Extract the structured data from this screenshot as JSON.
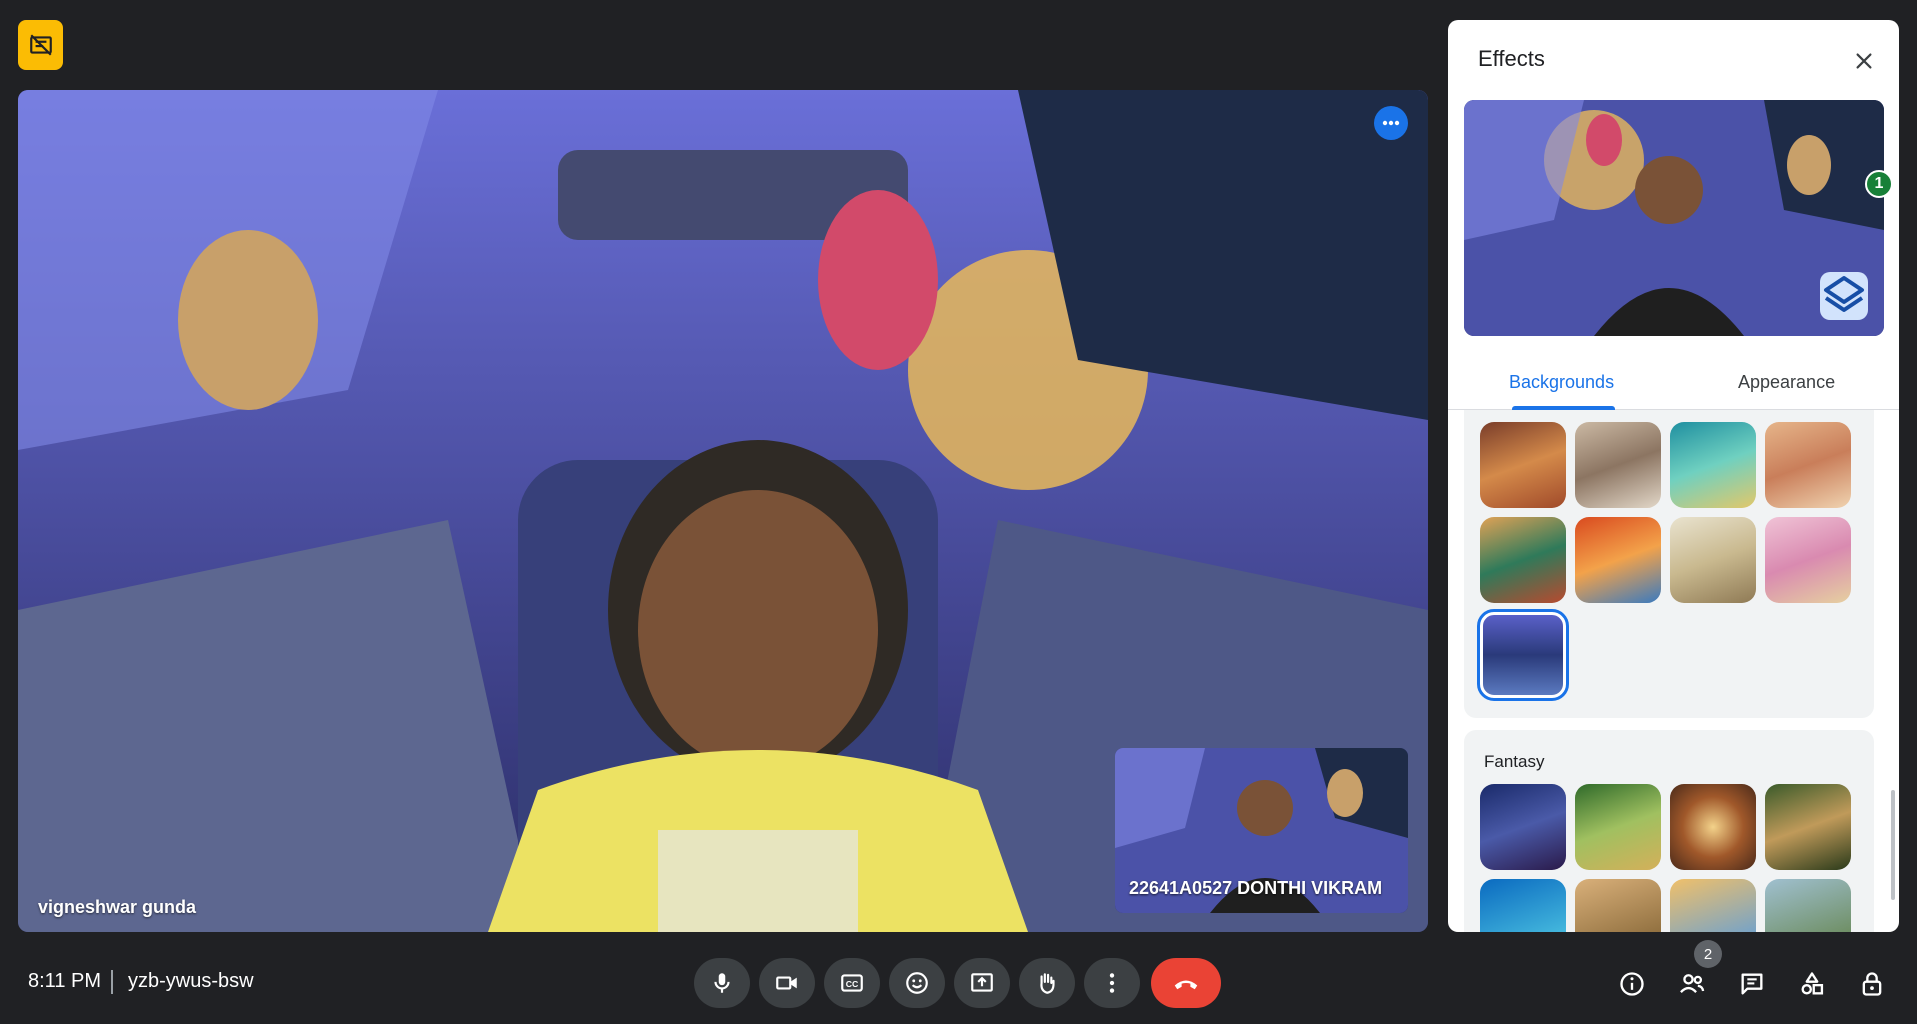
{
  "call": {
    "time": "8:11 PM",
    "meeting_code": "yzb-ywus-bsw"
  },
  "participants": {
    "main_name": "vigneshwar gunda",
    "self_name": "22641A0527 DONTHI VIKRAM",
    "count": "2"
  },
  "effects_panel": {
    "title": "Effects",
    "tabs": [
      {
        "label": "Backgrounds",
        "active": true
      },
      {
        "label": "Appearance",
        "active": false
      }
    ],
    "applied_effects_count": "1",
    "section_title": "Fantasy",
    "background_thumbs": [
      {
        "icon": "cozy-room"
      },
      {
        "icon": "living-room"
      },
      {
        "icon": "underwater"
      },
      {
        "icon": "paris-balcony"
      },
      {
        "icon": "cafe"
      },
      {
        "icon": "kitchen"
      },
      {
        "icon": "minimal-room"
      },
      {
        "icon": "pink-landscape"
      },
      {
        "icon": "spaceship",
        "selected": true
      }
    ],
    "fantasy_thumbs": [
      {
        "icon": "throne-hall"
      },
      {
        "icon": "forest-tent"
      },
      {
        "icon": "glowing-portal"
      },
      {
        "icon": "tree-house"
      },
      {
        "icon": "ocean"
      },
      {
        "icon": "desert-city"
      },
      {
        "icon": "castle"
      },
      {
        "icon": "ruins"
      }
    ]
  },
  "colors": {
    "accent": "#1a73e8",
    "end_call": "#ea4335",
    "recording_badge": "#fbbc04",
    "background": "#202124"
  }
}
